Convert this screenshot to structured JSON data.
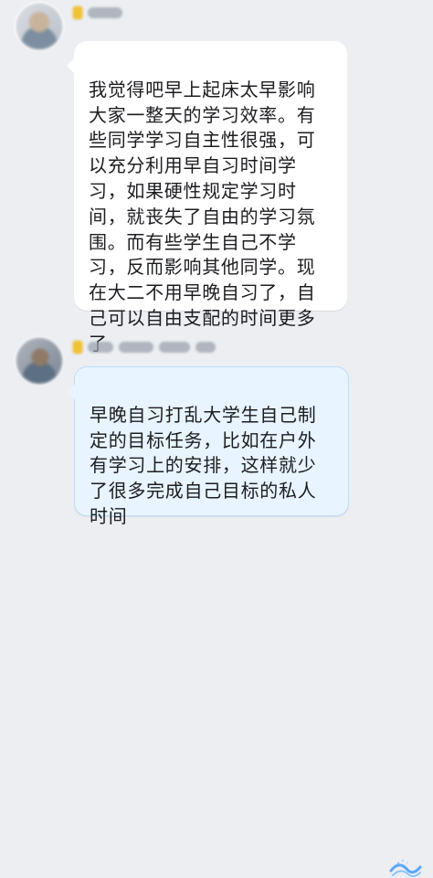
{
  "messages": [
    {
      "text": "我觉得吧早上起床太早影响\n大家一整天的学习效率。有\n些同学学习自主性很强，可\n以充分利用早自习时间学\n习，如果硬性规定学习时\n间，就丧失了自由的学习氛\n围。而有些学生自己不学\n习，反而影响其他同学。现\n在大二不用早晚自习了，自\n己可以自由支配的时间更多\n了"
    },
    {
      "text": "早晚自习打乱大学生自己制\n定的目标任务，比如在户外\n有学习上的安排，这样就少\n了很多完成自己目标的私人\n时间"
    }
  ],
  "icons": {
    "badge": "gold-badge-icon",
    "wave": "wave-icon"
  },
  "colors": {
    "background": "#eceef2",
    "left_bubble": "#ffffff",
    "right_bubble": "#e8f4ff",
    "right_bubble_border": "#bfdcff",
    "badge": "#f1c232"
  }
}
